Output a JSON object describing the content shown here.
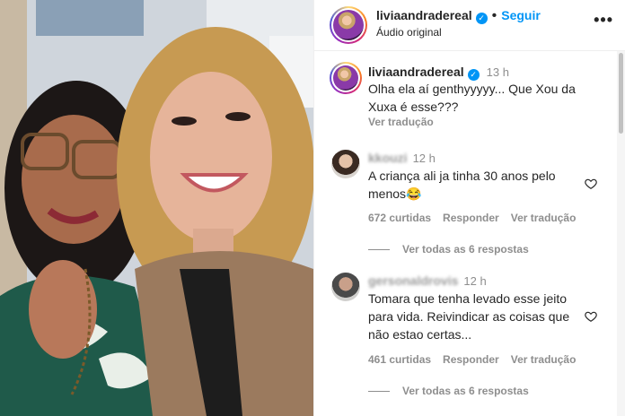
{
  "post": {
    "username": "liviaandradereal",
    "follow_label": "Seguir",
    "audio_label": "Áudio original",
    "more_label": "•••"
  },
  "caption": {
    "username": "liviaandradereal",
    "time": "13 h",
    "text_line1": "Olha ela aí genthyyyyy... Que Xou da",
    "text_line2": "Xuxa é esse???",
    "translate_label": "Ver tradução"
  },
  "comments": [
    {
      "username": "kkouzi",
      "time": "12 h",
      "text_line1": "A criança ali ja tinha 30 anos pelo",
      "text_line2": "menos😂",
      "likes": "672 curtidas",
      "reply_label": "Responder",
      "translate_label": "Ver tradução",
      "replies_label": "Ver todas as 6 respostas"
    },
    {
      "username": "gersonaldrovis",
      "time": "12 h",
      "text_line1": "Tomara que tenha levado esse jeito",
      "text_line2": "para vida. Reivindicar as coisas que",
      "text_line3": "não estao certas...",
      "likes": "461 curtidas",
      "reply_label": "Responder",
      "translate_label": "Ver tradução",
      "replies_label": "Ver todas as 6 respostas"
    }
  ],
  "colors": {
    "accent": "#0095f6",
    "muted": "#8e8e8e",
    "text": "#262626"
  }
}
